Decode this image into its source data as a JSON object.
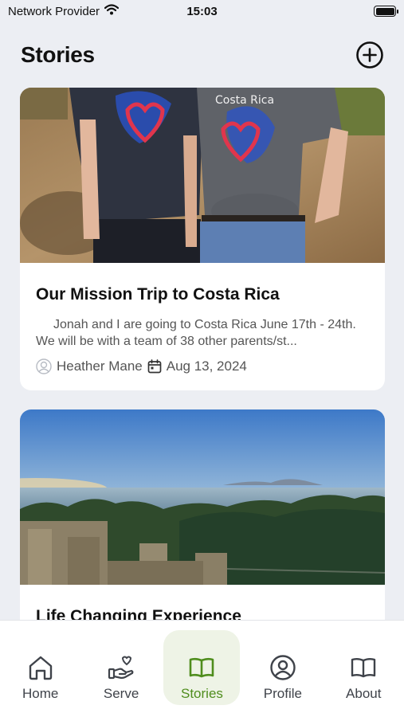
{
  "status_bar": {
    "carrier": "Network Provider",
    "time": "15:03"
  },
  "header": {
    "title": "Stories"
  },
  "stories": [
    {
      "title": "Our Mission Trip to Costa Rica",
      "excerpt": "Jonah and I are going to Costa Rica June 17th - 24th. We will be with a team of 38 other parents/st...",
      "author": "Heather Mane",
      "date": "Aug 13, 2024",
      "image_text": "Costa Rica"
    },
    {
      "title": "Life Changing Experience"
    }
  ],
  "tabs": [
    {
      "label": "Home",
      "icon": "home-icon",
      "active": false
    },
    {
      "label": "Serve",
      "icon": "hand-heart-icon",
      "active": false
    },
    {
      "label": "Stories",
      "icon": "book-icon",
      "active": true
    },
    {
      "label": "Profile",
      "icon": "user-circle-icon",
      "active": false
    },
    {
      "label": "About",
      "icon": "open-book-icon",
      "active": false
    }
  ],
  "colors": {
    "accent": "#4f8d1d",
    "accent_bg": "#eef3e6",
    "background": "#eceef3"
  }
}
